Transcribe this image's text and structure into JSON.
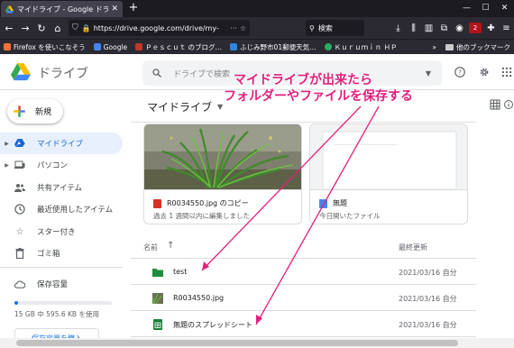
{
  "browser": {
    "tab_title": "マイドライブ - Google ドライブ",
    "url": "https://drive.google.com/drive/my-",
    "search_placeholder": "検索",
    "badge_count": "2",
    "bookmarks": [
      {
        "label": "Firefox を使いこなそう",
        "color": "#ff7139"
      },
      {
        "label": "Google",
        "color": "#4285f4"
      },
      {
        "label": "Ｐｅｓｃｕｔ のブログ…",
        "color": "#c0392b"
      },
      {
        "label": "ふじみ野市01郵便天気…",
        "color": "#2e86de"
      },
      {
        "label": "Ｋｕｒｕｍｉｎ  ＨＰ",
        "color": "#27ae60"
      }
    ],
    "other_bookmarks": "他のブックマーク"
  },
  "drive": {
    "app_name": "ドライブ",
    "search_placeholder": "ドライブで検索",
    "new_button": "新規",
    "nav": [
      {
        "label": "マイドライブ",
        "icon": "drive-icon",
        "active": true
      },
      {
        "label": "パソコン",
        "icon": "computer-icon",
        "active": false
      },
      {
        "label": "共有アイテム",
        "icon": "people-icon",
        "active": false
      },
      {
        "label": "最近使用したアイテム",
        "icon": "clock-icon",
        "active": false
      },
      {
        "label": "スター付き",
        "icon": "star-icon",
        "active": false
      },
      {
        "label": "ゴミ箱",
        "icon": "trash-icon",
        "active": false
      }
    ],
    "storage_label": "保存容量",
    "storage_fraction": 0.04,
    "storage_usage": "15 GB 中 595.6 KB を使用",
    "buy_storage": "保存容量を購入",
    "main_title": "マイドライブ",
    "suggested": [
      {
        "name": "R0034550.jpg のコピー",
        "subtitle": "過去 1 週間以内に編集しました",
        "icon_color": "#d93025"
      },
      {
        "name": "無題",
        "subtitle": "今日開いたファイル",
        "icon_color": "#4285f4"
      }
    ],
    "list_header": {
      "name": "名前",
      "modified": "最終更新"
    },
    "files": [
      {
        "name": "test",
        "date": "2021/03/16 自分",
        "type": "folder"
      },
      {
        "name": "R0034550.jpg",
        "date": "2021/03/16 自分",
        "type": "image"
      },
      {
        "name": "無題のスプレッドシート",
        "date": "2021/03/16 自分",
        "type": "sheet"
      }
    ]
  },
  "annotation": {
    "line1": "マイドライブが出来たら",
    "line2": "フォルダーやファイルを保存する",
    "color": "#e0207e"
  }
}
